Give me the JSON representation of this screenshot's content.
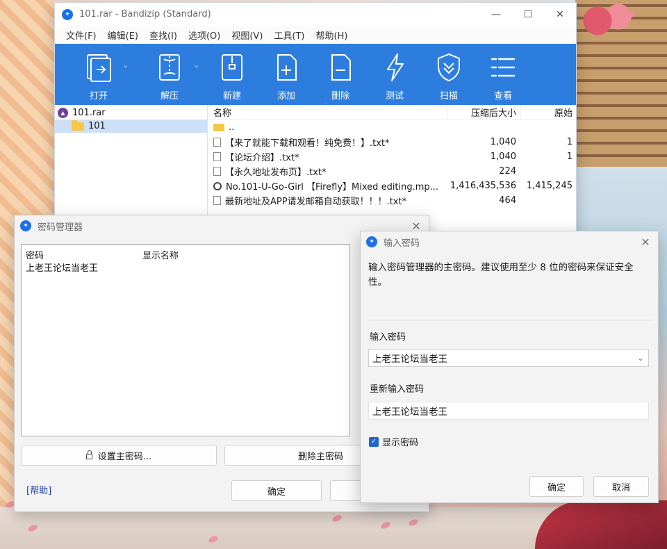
{
  "bandizip": {
    "title": "101.rar - Bandizip (Standard)",
    "menus": [
      "文件(F)",
      "编辑(E)",
      "查找(I)",
      "选项(O)",
      "视图(V)",
      "工具(T)",
      "帮助(H)"
    ],
    "toolbar": [
      "打开",
      "解压",
      "新建",
      "添加",
      "删除",
      "测试",
      "扫描",
      "查看"
    ],
    "tree": {
      "root": "101.rar",
      "folder": "101"
    },
    "columns": {
      "name": "名称",
      "compressed": "压缩后大小",
      "original": "原始"
    },
    "files": [
      {
        "name": "..",
        "compressed": "",
        "original": "",
        "icon": "folder-icon"
      },
      {
        "name": "【来了就能下载和观看！纯免费！】.txt*",
        "compressed": "1,040",
        "original": "1",
        "icon": "text-file-icon"
      },
      {
        "name": "【论坛介绍】.txt*",
        "compressed": "1,040",
        "original": "1",
        "icon": "text-file-icon"
      },
      {
        "name": "【永久地址发布页】.txt*",
        "compressed": "224",
        "original": "",
        "icon": "text-file-icon"
      },
      {
        "name": "No.101-U-Go-Girl 【Firefly】Mixed editing.mp...",
        "compressed": "1,416,435,536",
        "original": "1,415,245",
        "icon": "video-file-icon"
      },
      {
        "name": "最新地址及APP请发邮箱自动获取！！！.txt*",
        "compressed": "464",
        "original": "",
        "icon": "text-file-icon"
      }
    ],
    "accent": "#2d7ddf"
  },
  "password_manager": {
    "title": "密码管理器",
    "col_password": "密码",
    "col_display_name": "显示名称",
    "rows": [
      {
        "password": "上老王论坛当老王",
        "display_name": ""
      }
    ],
    "set_master_button": "设置主密码...",
    "delete_master_button": "删除主密码",
    "ok_button": "确定",
    "help_link": "[帮助]"
  },
  "enter_password": {
    "title": "输入密码",
    "description": "输入密码管理器的主密码。建议使用至少 8 位的密码来保证安全性。",
    "password_label": "输入密码",
    "password_value": "上老王论坛当老王",
    "confirm_label": "重新输入密码",
    "confirm_value": "上老王论坛当老王",
    "show_password_label": "显示密码",
    "show_password_checked": true,
    "ok_button": "确定",
    "cancel_button": "取消"
  }
}
